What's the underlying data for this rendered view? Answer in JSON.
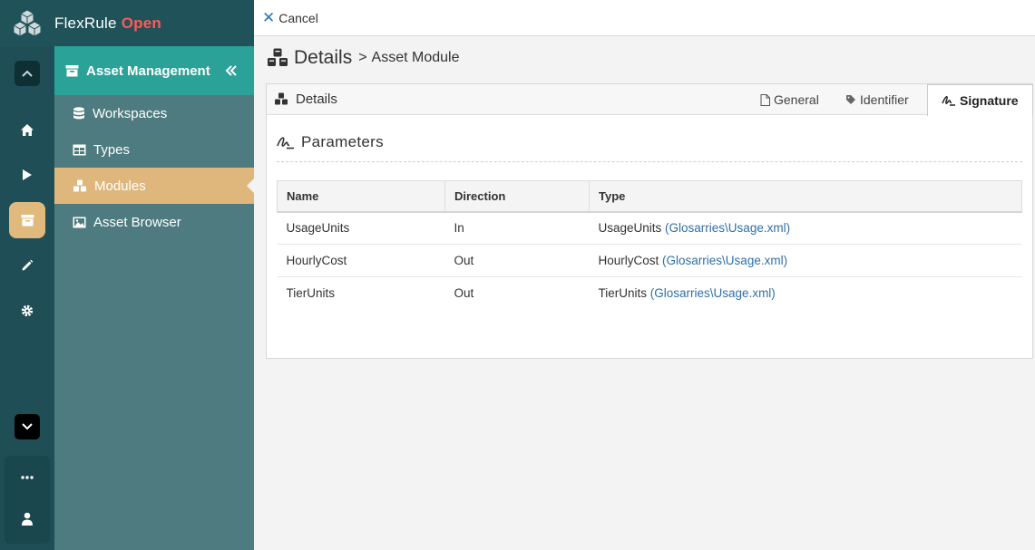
{
  "brand": {
    "name": "FlexRule",
    "edition": "Open"
  },
  "sidebar": {
    "header": "Asset Management",
    "items": [
      {
        "label": "Workspaces",
        "icon": "database-icon"
      },
      {
        "label": "Types",
        "icon": "table-icon"
      },
      {
        "label": "Modules",
        "icon": "cubes-icon",
        "active": true
      },
      {
        "label": "Asset Browser",
        "icon": "image-icon"
      }
    ]
  },
  "rail": {
    "items": [
      "chevron-up-icon",
      "home-icon",
      "play-icon",
      "archive-icon",
      "pencil-icon",
      "gear-icon",
      "chevron-down-icon",
      "more-icon",
      "user-icon"
    ]
  },
  "topbar": {
    "cancel_label": "Cancel"
  },
  "page": {
    "title": "Details",
    "separator": ">",
    "subtitle": "Asset Module"
  },
  "tabs": {
    "details_label": "Details",
    "general": "General",
    "identifier": "Identifier",
    "signature": "Signature"
  },
  "section": {
    "title": "Parameters"
  },
  "table": {
    "headers": [
      "Name",
      "Direction",
      "Type"
    ],
    "rows": [
      {
        "name": "UsageUnits",
        "direction": "In",
        "type": "UsageUnits",
        "source": "(Glosarries\\Usage.xml)"
      },
      {
        "name": "HourlyCost",
        "direction": "Out",
        "type": "HourlyCost",
        "source": "(Glosarries\\Usage.xml)"
      },
      {
        "name": "TierUnits",
        "direction": "Out",
        "type": "TierUnits",
        "source": "(Glosarries\\Usage.xml)"
      }
    ]
  },
  "colors": {
    "rail": "#1f4e56",
    "sidebar": "#4e7b7f",
    "sidebar_header": "#2ba298",
    "active": "#dfb77d",
    "brand_open": "#ff5a57",
    "link": "#2f6fa8"
  }
}
